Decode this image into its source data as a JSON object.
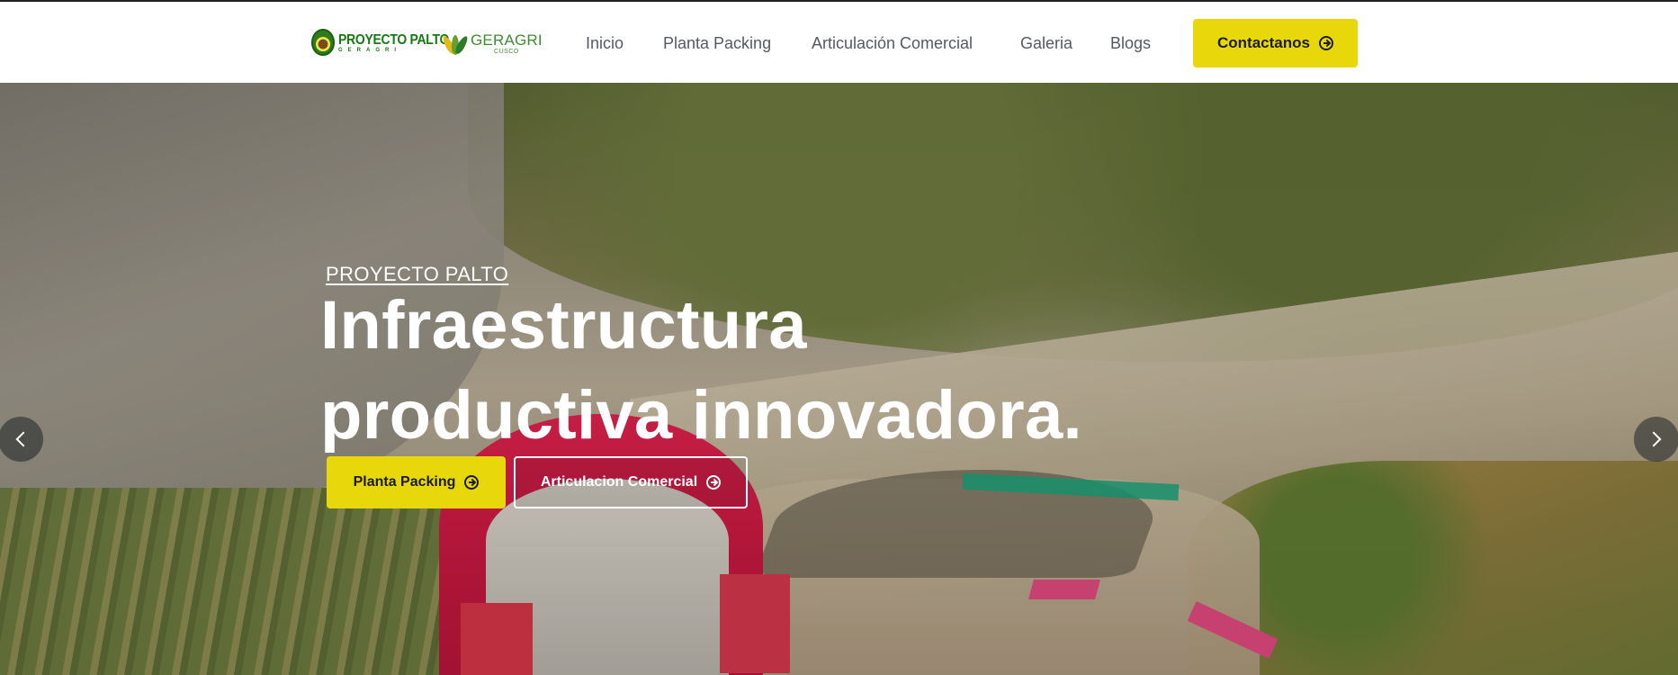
{
  "header": {
    "logo_primary": {
      "text": "PROYECTO PALTO",
      "subtext": "GERAGRI"
    },
    "logo_secondary": {
      "text": "GERAGRI",
      "subtext": "CUSCO"
    },
    "nav": [
      {
        "label": "Inicio"
      },
      {
        "label": "Planta Packing"
      },
      {
        "label": "Articulación Comercial"
      },
      {
        "label": "Galeria"
      },
      {
        "label": "Blogs"
      }
    ],
    "cta": {
      "label": "Contactanos",
      "icon": "arrow-circle-right-icon"
    }
  },
  "hero": {
    "kicker": "PROYECTO PALTO",
    "headline": "Infraestructura productiva innovadora.",
    "buttons": [
      {
        "label": "Planta Packing",
        "icon": "arrow-circle-right-icon"
      },
      {
        "label": "Articulacion Comercial",
        "icon": "arrow-circle-right-icon"
      }
    ],
    "background": "aerial photo of red dome greenhouse and packing plant in valley",
    "carousel": {
      "prev_icon": "chevron-left-icon",
      "next_icon": "chevron-right-icon"
    }
  },
  "colors": {
    "accent": "#e8d80b",
    "nav_text": "#555a62",
    "logo_green": "#157a12",
    "hero_text": "#ffffff"
  }
}
